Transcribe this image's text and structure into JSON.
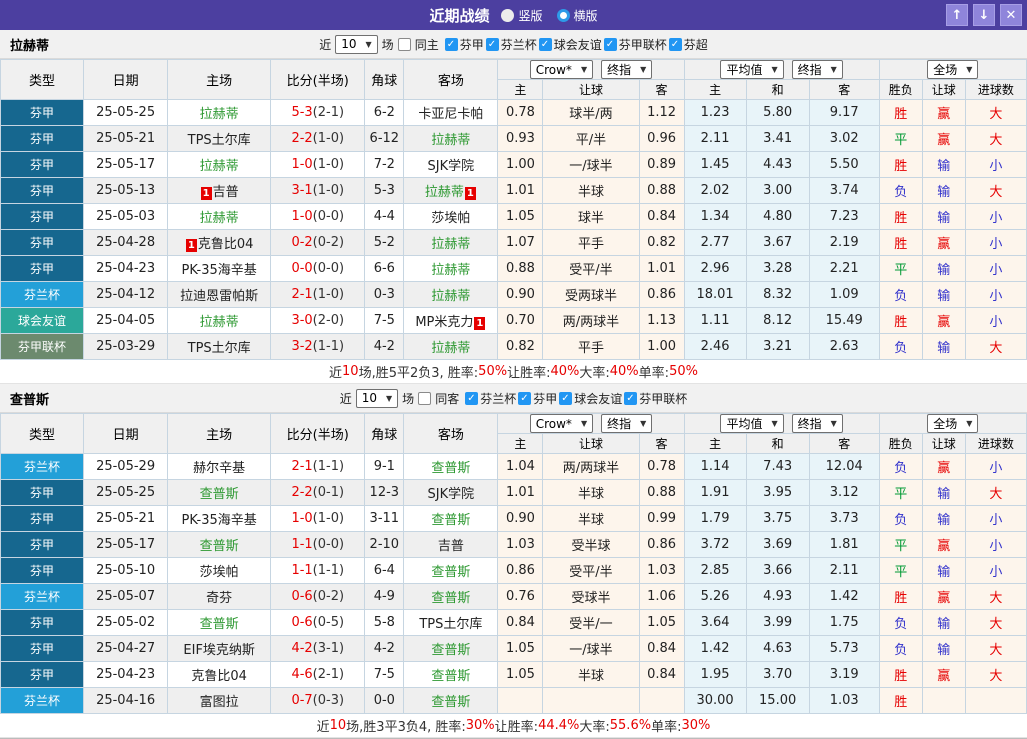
{
  "titlebar": {
    "title": "近期战绩",
    "layout_radios": [
      {
        "label": "竖版",
        "selected": false
      },
      {
        "label": "横版",
        "selected": true
      }
    ],
    "buttons": {
      "up": "↑",
      "down": "↓",
      "close": "✕"
    }
  },
  "filter_labels": {
    "near": "近",
    "games": "场"
  },
  "columns": {
    "type": "类型",
    "date": "日期",
    "home": "主场",
    "score": "比分(半场)",
    "corner": "角球",
    "away": "客场",
    "dropdowns": {
      "crow": "Crow*",
      "final1": "终指",
      "avg": "平均值",
      "final2": "终指",
      "full": "全场"
    },
    "sub": [
      "主",
      "让球",
      "客",
      "主",
      "和",
      "客",
      "胜负",
      "让球",
      "进球数"
    ]
  },
  "type_colors": {
    "芬甲": "#16678F",
    "芬兰杯": "#23A0D8",
    "球会友谊": "#2BA89A",
    "芬甲联杯": "#6C8A6E"
  },
  "result_colors": {
    "胜": "#E60000",
    "平": "#009933",
    "负": "#3333CC",
    "赢": "#E60000",
    "输": "#3333CC",
    "大": "#E60000",
    "小": "#3333CC"
  },
  "accent_colors": {
    "focus_team": "#2E9932",
    "score": "#E60000",
    "badge": "#E60000",
    "titlebar": "#4C3FA0"
  },
  "sections": [
    {
      "team": "拉赫蒂",
      "filter": {
        "matches": "10",
        "same_label": "同主",
        "same_checked": false,
        "leagues": [
          {
            "label": "芬甲",
            "checked": true
          },
          {
            "label": "芬兰杯",
            "checked": true
          },
          {
            "label": "球会友谊",
            "checked": true
          },
          {
            "label": "芬甲联杯",
            "checked": true
          },
          {
            "label": "芬超",
            "checked": true
          }
        ]
      },
      "rows": [
        {
          "type": "芬甲",
          "date": "25-05-25",
          "home": "拉赫蒂",
          "home_focus": true,
          "home_badge": "",
          "score": "5-3",
          "half": "(2-1)",
          "corner": "6-2",
          "away": "卡亚尼卡帕",
          "away_focus": false,
          "away_badge": "",
          "crow_home": "0.78",
          "handicap": "球半/两",
          "crow_away": "1.12",
          "avg_home": "1.23",
          "avg_draw": "5.80",
          "avg_away": "9.17",
          "res": "胜",
          "res_handicap": "赢",
          "res_goals": "大"
        },
        {
          "type": "芬甲",
          "date": "25-05-21",
          "home": "TPS土尔库",
          "home_focus": false,
          "home_badge": "",
          "score": "2-2",
          "half": "(1-0)",
          "corner": "6-12",
          "away": "拉赫蒂",
          "away_focus": true,
          "away_badge": "",
          "crow_home": "0.93",
          "handicap": "平/半",
          "crow_away": "0.96",
          "avg_home": "2.11",
          "avg_draw": "3.41",
          "avg_away": "3.02",
          "res": "平",
          "res_handicap": "赢",
          "res_goals": "大"
        },
        {
          "type": "芬甲",
          "date": "25-05-17",
          "home": "拉赫蒂",
          "home_focus": true,
          "home_badge": "",
          "score": "1-0",
          "half": "(1-0)",
          "corner": "7-2",
          "away": "SJK学院",
          "away_focus": false,
          "away_badge": "",
          "crow_home": "1.00",
          "handicap": "一/球半",
          "crow_away": "0.89",
          "avg_home": "1.45",
          "avg_draw": "4.43",
          "avg_away": "5.50",
          "res": "胜",
          "res_handicap": "输",
          "res_goals": "小"
        },
        {
          "type": "芬甲",
          "date": "25-05-13",
          "home": "吉普",
          "home_focus": false,
          "home_badge": "1",
          "score": "3-1",
          "half": "(1-0)",
          "corner": "5-3",
          "away": "拉赫蒂",
          "away_focus": true,
          "away_badge": "1",
          "crow_home": "1.01",
          "handicap": "半球",
          "crow_away": "0.88",
          "avg_home": "2.02",
          "avg_draw": "3.00",
          "avg_away": "3.74",
          "res": "负",
          "res_handicap": "输",
          "res_goals": "大"
        },
        {
          "type": "芬甲",
          "date": "25-05-03",
          "home": "拉赫蒂",
          "home_focus": true,
          "home_badge": "",
          "score": "1-0",
          "half": "(0-0)",
          "corner": "4-4",
          "away": "莎埃帕",
          "away_focus": false,
          "away_badge": "",
          "crow_home": "1.05",
          "handicap": "球半",
          "crow_away": "0.84",
          "avg_home": "1.34",
          "avg_draw": "4.80",
          "avg_away": "7.23",
          "res": "胜",
          "res_handicap": "输",
          "res_goals": "小"
        },
        {
          "type": "芬甲",
          "date": "25-04-28",
          "home": "克鲁比04",
          "home_focus": false,
          "home_badge": "1",
          "score": "0-2",
          "half": "(0-2)",
          "corner": "5-2",
          "away": "拉赫蒂",
          "away_focus": true,
          "away_badge": "",
          "crow_home": "1.07",
          "handicap": "平手",
          "crow_away": "0.82",
          "avg_home": "2.77",
          "avg_draw": "3.67",
          "avg_away": "2.19",
          "res": "胜",
          "res_handicap": "赢",
          "res_goals": "小"
        },
        {
          "type": "芬甲",
          "date": "25-04-23",
          "home": "PK-35海辛基",
          "home_focus": false,
          "home_badge": "",
          "score": "0-0",
          "half": "(0-0)",
          "corner": "6-6",
          "away": "拉赫蒂",
          "away_focus": true,
          "away_badge": "",
          "crow_home": "0.88",
          "handicap": "受平/半",
          "crow_away": "1.01",
          "avg_home": "2.96",
          "avg_draw": "3.28",
          "avg_away": "2.21",
          "res": "平",
          "res_handicap": "输",
          "res_goals": "小"
        },
        {
          "type": "芬兰杯",
          "date": "25-04-12",
          "home": "拉迪恩雷帕斯",
          "home_focus": false,
          "home_badge": "",
          "score": "2-1",
          "half": "(1-0)",
          "corner": "0-3",
          "away": "拉赫蒂",
          "away_focus": true,
          "away_badge": "",
          "crow_home": "0.90",
          "handicap": "受两球半",
          "crow_away": "0.86",
          "avg_home": "18.01",
          "avg_draw": "8.32",
          "avg_away": "1.09",
          "res": "负",
          "res_handicap": "输",
          "res_goals": "小"
        },
        {
          "type": "球会友谊",
          "date": "25-04-05",
          "home": "拉赫蒂",
          "home_focus": true,
          "home_badge": "",
          "score": "3-0",
          "half": "(2-0)",
          "corner": "7-5",
          "away": "MP米克力",
          "away_focus": false,
          "away_badge": "1",
          "crow_home": "0.70",
          "handicap": "两/两球半",
          "crow_away": "1.13",
          "avg_home": "1.11",
          "avg_draw": "8.12",
          "avg_away": "15.49",
          "res": "胜",
          "res_handicap": "赢",
          "res_goals": "小"
        },
        {
          "type": "芬甲联杯",
          "date": "25-03-29",
          "home": "TPS土尔库",
          "home_focus": false,
          "home_badge": "",
          "score": "3-2",
          "half": "(1-1)",
          "corner": "4-2",
          "away": "拉赫蒂",
          "away_focus": true,
          "away_badge": "",
          "crow_home": "0.82",
          "handicap": "平手",
          "crow_away": "1.00",
          "avg_home": "2.46",
          "avg_draw": "3.21",
          "avg_away": "2.63",
          "res": "负",
          "res_handicap": "输",
          "res_goals": "大"
        }
      ],
      "summary": [
        {
          "t": "近"
        },
        {
          "t": "10",
          "red": true
        },
        {
          "t": "场,胜5平2负3, 胜率:"
        },
        {
          "t": "50%",
          "red": true
        },
        {
          "t": " 让胜率:"
        },
        {
          "t": "40%",
          "red": true
        },
        {
          "t": " 大率:"
        },
        {
          "t": "40%",
          "red": true
        },
        {
          "t": " 单率:"
        },
        {
          "t": "50%",
          "red": true
        }
      ]
    },
    {
      "team": "查普斯",
      "filter": {
        "matches": "10",
        "same_label": "同客",
        "same_checked": false,
        "leagues": [
          {
            "label": "芬兰杯",
            "checked": true
          },
          {
            "label": "芬甲",
            "checked": true
          },
          {
            "label": "球会友谊",
            "checked": true
          },
          {
            "label": "芬甲联杯",
            "checked": true
          }
        ]
      },
      "rows": [
        {
          "type": "芬兰杯",
          "date": "25-05-29",
          "home": "赫尔辛基",
          "home_focus": false,
          "home_badge": "",
          "score": "2-1",
          "half": "(1-1)",
          "corner": "9-1",
          "away": "查普斯",
          "away_focus": true,
          "away_badge": "",
          "crow_home": "1.04",
          "handicap": "两/两球半",
          "crow_away": "0.78",
          "avg_home": "1.14",
          "avg_draw": "7.43",
          "avg_away": "12.04",
          "res": "负",
          "res_handicap": "赢",
          "res_goals": "小"
        },
        {
          "type": "芬甲",
          "date": "25-05-25",
          "home": "查普斯",
          "home_focus": true,
          "home_badge": "",
          "score": "2-2",
          "half": "(0-1)",
          "corner": "12-3",
          "away": "SJK学院",
          "away_focus": false,
          "away_badge": "",
          "crow_home": "1.01",
          "handicap": "半球",
          "crow_away": "0.88",
          "avg_home": "1.91",
          "avg_draw": "3.95",
          "avg_away": "3.12",
          "res": "平",
          "res_handicap": "输",
          "res_goals": "大"
        },
        {
          "type": "芬甲",
          "date": "25-05-21",
          "home": "PK-35海辛基",
          "home_focus": false,
          "home_badge": "",
          "score": "1-0",
          "half": "(1-0)",
          "corner": "3-11",
          "away": "查普斯",
          "away_focus": true,
          "away_badge": "",
          "crow_home": "0.90",
          "handicap": "半球",
          "crow_away": "0.99",
          "avg_home": "1.79",
          "avg_draw": "3.75",
          "avg_away": "3.73",
          "res": "负",
          "res_handicap": "输",
          "res_goals": "小"
        },
        {
          "type": "芬甲",
          "date": "25-05-17",
          "home": "查普斯",
          "home_focus": true,
          "home_badge": "",
          "score": "1-1",
          "half": "(0-0)",
          "corner": "2-10",
          "away": "吉普",
          "away_focus": false,
          "away_badge": "",
          "crow_home": "1.03",
          "handicap": "受半球",
          "crow_away": "0.86",
          "avg_home": "3.72",
          "avg_draw": "3.69",
          "avg_away": "1.81",
          "res": "平",
          "res_handicap": "赢",
          "res_goals": "小"
        },
        {
          "type": "芬甲",
          "date": "25-05-10",
          "home": "莎埃帕",
          "home_focus": false,
          "home_badge": "",
          "score": "1-1",
          "half": "(1-1)",
          "corner": "6-4",
          "away": "查普斯",
          "away_focus": true,
          "away_badge": "",
          "crow_home": "0.86",
          "handicap": "受平/半",
          "crow_away": "1.03",
          "avg_home": "2.85",
          "avg_draw": "3.66",
          "avg_away": "2.11",
          "res": "平",
          "res_handicap": "输",
          "res_goals": "小"
        },
        {
          "type": "芬兰杯",
          "date": "25-05-07",
          "home": "奇芬",
          "home_focus": false,
          "home_badge": "",
          "score": "0-6",
          "half": "(0-2)",
          "corner": "4-9",
          "away": "查普斯",
          "away_focus": true,
          "away_badge": "",
          "crow_home": "0.76",
          "handicap": "受球半",
          "crow_away": "1.06",
          "avg_home": "5.26",
          "avg_draw": "4.93",
          "avg_away": "1.42",
          "res": "胜",
          "res_handicap": "赢",
          "res_goals": "大"
        },
        {
          "type": "芬甲",
          "date": "25-05-02",
          "home": "查普斯",
          "home_focus": true,
          "home_badge": "",
          "score": "0-6",
          "half": "(0-5)",
          "corner": "5-8",
          "away": "TPS土尔库",
          "away_focus": false,
          "away_badge": "",
          "crow_home": "0.84",
          "handicap": "受半/一",
          "crow_away": "1.05",
          "avg_home": "3.64",
          "avg_draw": "3.99",
          "avg_away": "1.75",
          "res": "负",
          "res_handicap": "输",
          "res_goals": "大"
        },
        {
          "type": "芬甲",
          "date": "25-04-27",
          "home": "EIF埃克纳斯",
          "home_focus": false,
          "home_badge": "",
          "score": "4-2",
          "half": "(3-1)",
          "corner": "4-2",
          "away": "查普斯",
          "away_focus": true,
          "away_badge": "",
          "crow_home": "1.05",
          "handicap": "一/球半",
          "crow_away": "0.84",
          "avg_home": "1.42",
          "avg_draw": "4.63",
          "avg_away": "5.73",
          "res": "负",
          "res_handicap": "输",
          "res_goals": "大"
        },
        {
          "type": "芬甲",
          "date": "25-04-23",
          "home": "克鲁比04",
          "home_focus": false,
          "home_badge": "",
          "score": "4-6",
          "half": "(2-1)",
          "corner": "7-5",
          "away": "查普斯",
          "away_focus": true,
          "away_badge": "",
          "crow_home": "1.05",
          "handicap": "半球",
          "crow_away": "0.84",
          "avg_home": "1.95",
          "avg_draw": "3.70",
          "avg_away": "3.19",
          "res": "胜",
          "res_handicap": "赢",
          "res_goals": "大"
        },
        {
          "type": "芬兰杯",
          "date": "25-04-16",
          "home": "富图拉",
          "home_focus": false,
          "home_badge": "",
          "score": "0-7",
          "half": "(0-3)",
          "corner": "0-0",
          "away": "查普斯",
          "away_focus": true,
          "away_badge": "",
          "crow_home": "",
          "handicap": "",
          "crow_away": "",
          "avg_home": "30.00",
          "avg_draw": "15.00",
          "avg_away": "1.03",
          "res": "胜",
          "res_handicap": "",
          "res_goals": ""
        }
      ],
      "summary": [
        {
          "t": "近"
        },
        {
          "t": "10",
          "red": true
        },
        {
          "t": "场,胜3平3负4, 胜率:"
        },
        {
          "t": "30%",
          "red": true
        },
        {
          "t": " 让胜率:"
        },
        {
          "t": "44.4%",
          "red": true
        },
        {
          "t": " 大率:"
        },
        {
          "t": "55.6%",
          "red": true
        },
        {
          "t": " 单率:"
        },
        {
          "t": "30%",
          "red": true
        }
      ]
    }
  ]
}
